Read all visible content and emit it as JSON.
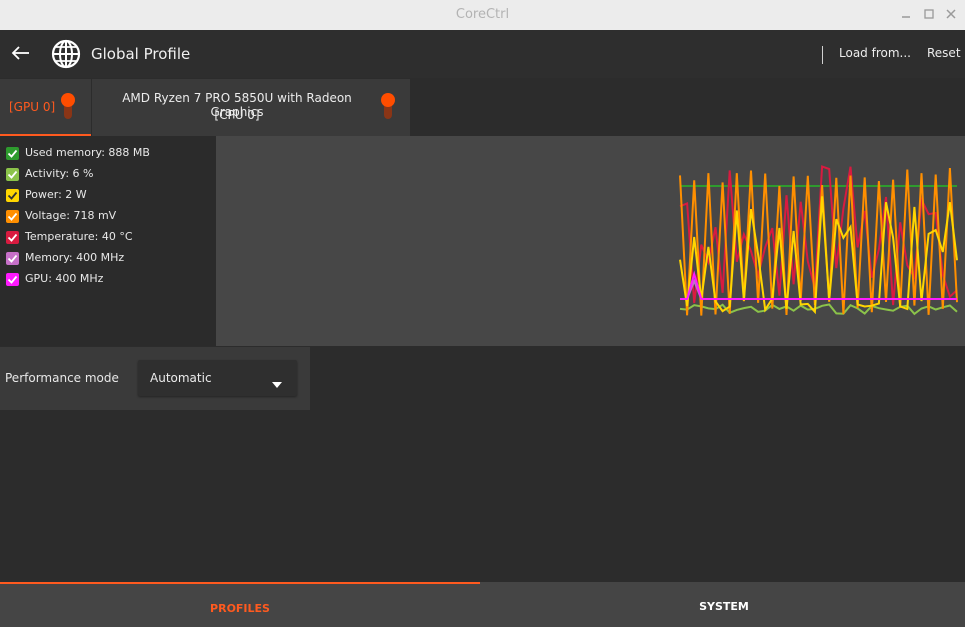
{
  "window": {
    "title": "CoreCtrl"
  },
  "header": {
    "title": "Global Profile",
    "load_label": "Load from...",
    "reset_label": "Reset"
  },
  "tabs": [
    {
      "label": "[GPU 0]",
      "active": true
    },
    {
      "label_line1": "AMD Ryzen 7 PRO 5850U with Radeon Graphics",
      "label_line2": "[CPU 0]",
      "active": false
    }
  ],
  "sensors": [
    {
      "label": "Used memory: 888 MB",
      "color": "#2e9b2e"
    },
    {
      "label": "Activity: 6 %",
      "color": "#8bc34a"
    },
    {
      "label": "Power: 2 W",
      "color": "#ffd600"
    },
    {
      "label": "Voltage: 718 mV",
      "color": "#ff8f00"
    },
    {
      "label": "Temperature: 40 °C",
      "color": "#d81b40"
    },
    {
      "label": "Memory: 400 MHz",
      "color": "#c670c8"
    },
    {
      "label": "GPU: 400 MHz",
      "color": "#ff1aff"
    }
  ],
  "performance": {
    "label": "Performance mode",
    "value": "Automatic"
  },
  "bottom_tabs": [
    {
      "label": "PROFILES",
      "active": true
    },
    {
      "label": "SYSTEM",
      "active": false
    }
  ],
  "colors": {
    "accent": "#ff5a1f",
    "background": "#2c2c2c",
    "panel": "#3a3a3a"
  }
}
